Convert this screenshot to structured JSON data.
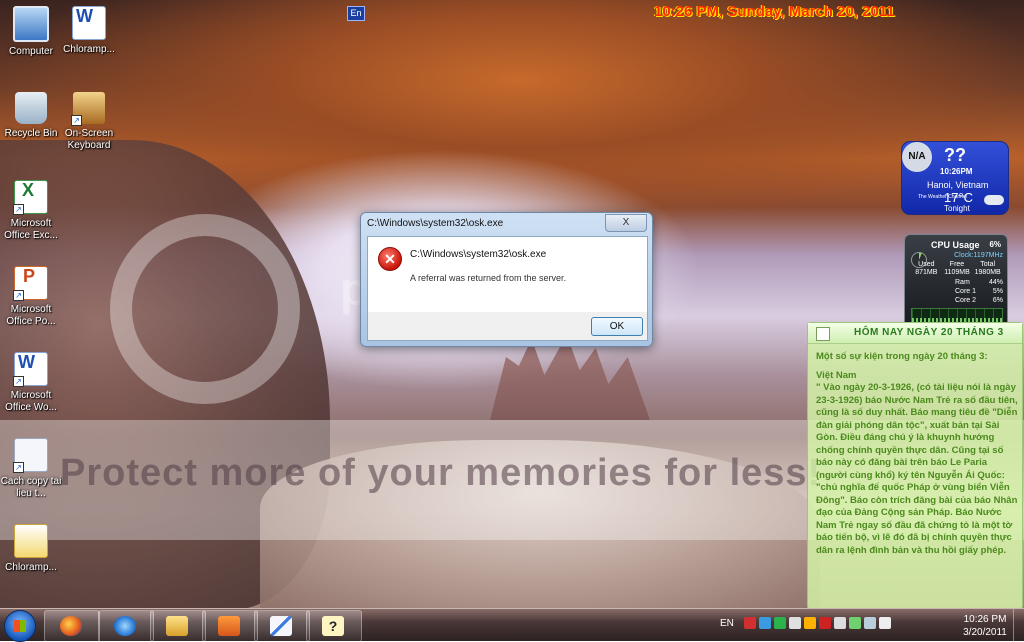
{
  "top_clock": "10:26 PM, Sunday, March 20, 2011",
  "lang_indicator": "En",
  "desktop_icons": [
    {
      "label": "Computer",
      "icon": "computer-icon"
    },
    {
      "label": "Chloramp...",
      "icon": "word-document-icon"
    },
    {
      "label": "Recycle Bin",
      "icon": "recycle-bin-icon"
    },
    {
      "label": "On-Screen Keyboard",
      "icon": "keyboard-icon"
    },
    {
      "label": "Microsoft Office Exc...",
      "icon": "excel-icon"
    },
    {
      "label": "Microsoft Office Po...",
      "icon": "powerpoint-icon"
    },
    {
      "label": "Microsoft Office Wo...",
      "icon": "word-icon"
    },
    {
      "label": "Cach copy tai lieu t...",
      "icon": "document-icon"
    },
    {
      "label": "Chloramp...",
      "icon": "pdf-icon"
    }
  ],
  "dialog": {
    "title": "C:\\Windows\\system32\\osk.exe",
    "close": "X",
    "path": "C:\\Windows\\system32\\osk.exe",
    "message": "A referral was returned from the server.",
    "ok": "OK"
  },
  "weather": {
    "badge": "N/A",
    "condition": "??",
    "time": "10:26PM",
    "city": "Hanoi, Vietnam",
    "temp": "17°C",
    "tonight": "Tonight",
    "channel": "The Weather Channel"
  },
  "cpu": {
    "title": "CPU Usage",
    "percent": "6%",
    "clock": "Clock:1197MHz",
    "headers": [
      "Used",
      "Free",
      "Total"
    ],
    "values": [
      "871MB",
      "1109MB",
      "1980MB"
    ],
    "ram_label": "Ram",
    "ram_pct": "44%",
    "core1_label": "Core 1",
    "core1_pct": "5%",
    "core2_label": "Core 2",
    "core2_pct": "6%"
  },
  "notes": {
    "title": "HÔM NAY NGÀY  20 THÁNG 3",
    "intro": "Một số sự kiện trong ngày 20 tháng 3:",
    "heading": "Việt Nam",
    "body": "\" Vào ngày 20-3-1926, (có tài liệu nói là ngày 23-3-1926) báo Nước Nam Trẻ ra số đầu tiên, cũng là số duy nhất. Báo mang tiêu đề \"Diễn đàn giải phóng dân tộc\", xuất bản tại Sài Gòn. Điều đáng chú ý là khuynh hướng chống chính quyền thực dân. Cũng tại số báo này có đăng bài trên báo Le Paria (người cùng khổ) ký tên Nguyễn Ái Quốc: \"chủ nghĩa đế quốc Pháp ở vùng biển Viễn Đông\". Báo còn trích đăng bài của báo Nhân đạo của Đảng Cộng sản Pháp. Báo Nước Nam Trẻ ngay số đầu đã chứng tỏ là một tờ báo tiến bộ, vì lẽ đó đã bị chính quyền thực dân ra lệnh đình bản và thu hồi giấy phép."
  },
  "watermark": {
    "brand": "photobucket",
    "tagline": "Protect more of your memories for less!"
  },
  "taskbar": {
    "pinned": [
      "firefox-icon",
      "internet-explorer-icon",
      "explorer-folder-icon",
      "media-player-icon",
      "paint-icon",
      "help-icon"
    ],
    "lang": "EN",
    "time": "10:26 PM",
    "date": "3/20/2011"
  }
}
